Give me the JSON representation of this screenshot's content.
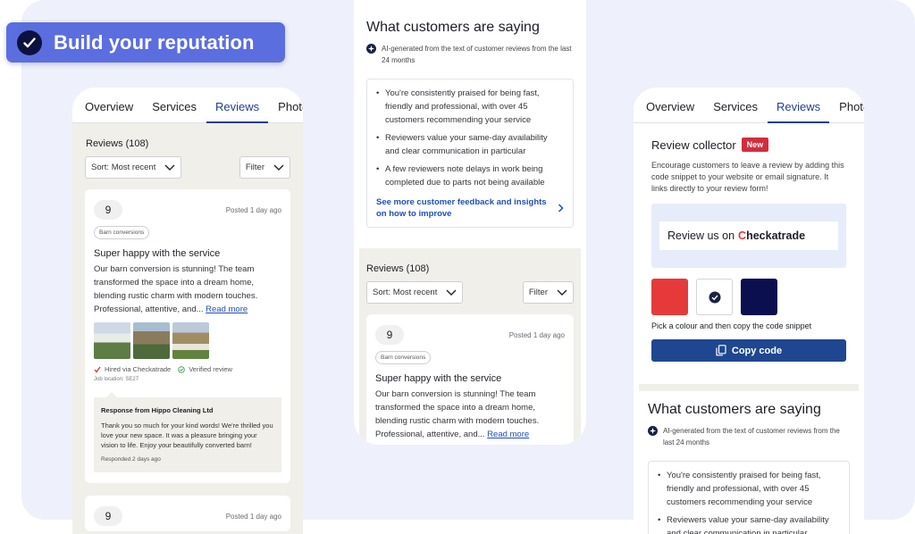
{
  "badge": {
    "label": "Build your reputation"
  },
  "tabs": [
    "Overview",
    "Services",
    "Reviews",
    "Photo"
  ],
  "reviews": {
    "header": "Reviews (108)",
    "sort_label": "Sort: Most recent",
    "filter_label": "Filter",
    "card": {
      "score": "9",
      "posted": "Posted 1 day ago",
      "tag": "Barn conversions",
      "title": "Super happy with the service",
      "body": "Our barn conversion is stunning! The team transformed the space into a dream home, blending rustic charm with modern touches. Professional, attentive, and...",
      "read_more": "Read more",
      "hired": "Hired via Checkatrade",
      "verified": "Verified review",
      "location": "Job location: SE27",
      "response": {
        "from": "Response from Hippo Cleaning Ltd",
        "text": "Thank you so much for your kind words! We're thrilled you love your new space. It was a pleasure bringing your vision to life. Enjoy your beautifully converted barn!",
        "when": "Responded 2 days ago"
      }
    }
  },
  "insights": {
    "title": "What customers are saying",
    "ai_note": "AI-generated from the text of customer reviews from the last 24 months",
    "bullets": [
      "You're consistently praised for being fast, friendly and professional, with over 45 customers recommending your service",
      "Reviewers value your same-day availability and clear communication in particular",
      "A few reviewers note delays in work being completed due to parts not being available"
    ],
    "more_link": "See more customer feedback and insights on how to improve"
  },
  "collector": {
    "title": "Review collector",
    "new_badge": "New",
    "description": "Encourage customers to leave a review by adding this code snippet to your website or email signature. It links directly to your review form!",
    "review_us": "Review us on",
    "brand_prefix": "C",
    "brand_rest": "heckatrade",
    "pick_label": "Pick a colour and then copy the code snippet",
    "copy_label": "Copy code",
    "colors": [
      "#e63a3a",
      "#ffffff",
      "#0b0e4f"
    ]
  }
}
